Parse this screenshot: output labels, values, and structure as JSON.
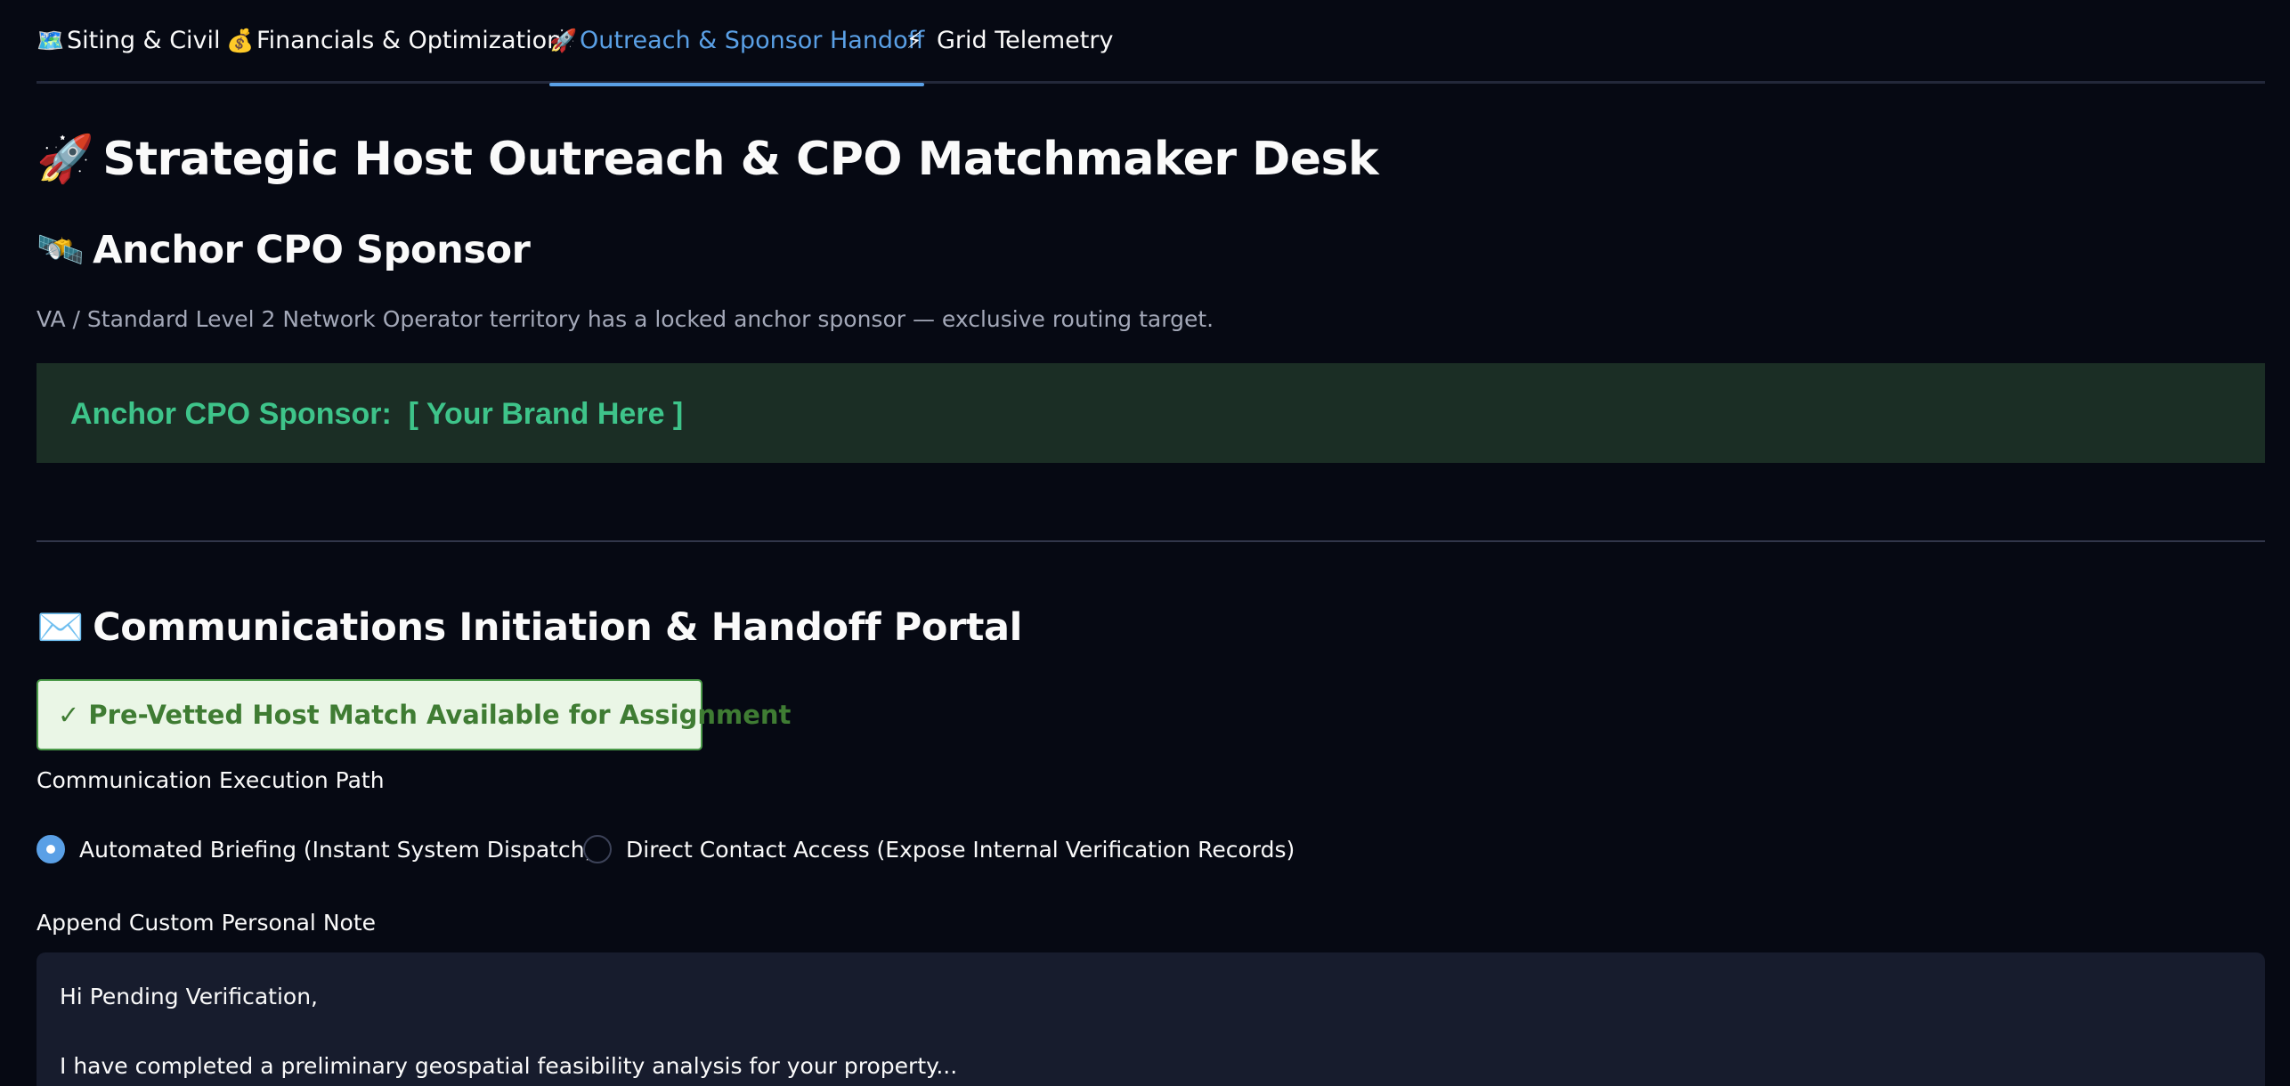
{
  "tabs": [
    {
      "icon": "🗺️",
      "label": "Siting & Civil"
    },
    {
      "icon": "💰",
      "label": "Financials & Optimization"
    },
    {
      "icon": "🚀",
      "label": "Outreach & Sponsor Handoff"
    },
    {
      "icon": "⚡",
      "label": "Grid Telemetry"
    }
  ],
  "active_tab": "Outreach & Sponsor Handoff",
  "page": {
    "title_icon": "🚀",
    "title": "Strategic Host Outreach & CPO Matchmaker Desk"
  },
  "sponsor": {
    "heading_icon": "🛰️",
    "heading": "Anchor CPO Sponsor",
    "caption": "VA / Standard Level 2 Network Operator territory has a locked anchor sponsor — exclusive routing target.",
    "banner_text": "Anchor CPO Sponsor:  [ Your Brand Here ]",
    "banner_color": "#3ec48a",
    "banner_bg": "#1b2e25"
  },
  "comms": {
    "heading_icon": "✉️",
    "heading": "Communications Initiation & Handoff Portal",
    "match_badge": "✓ Pre-Vetted Host Match Available for Assignment",
    "path_label": "Communication Execution Path",
    "options": [
      "Automated Briefing (Instant System Dispatch)",
      "Direct Contact Access (Expose Internal Verification Records)"
    ],
    "selected_option": "Automated Briefing (Instant System Dispatch)",
    "note_label": "Append Custom Personal Note",
    "note_value": "Hi Pending Verification,\n\nI have completed a preliminary geospatial feasibility analysis for your property..."
  },
  "colors": {
    "accent": "#5aa0e6",
    "background": "#060913",
    "success_text": "#3f7c33",
    "success_bg": "#eaf6e6"
  }
}
